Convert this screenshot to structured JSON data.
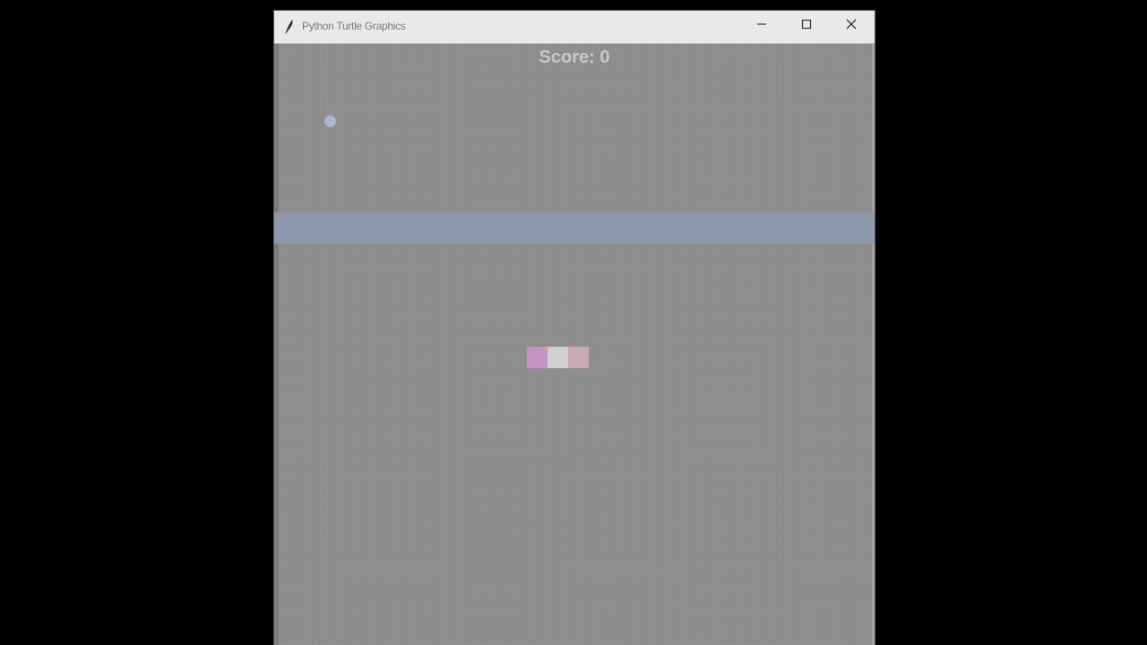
{
  "window": {
    "title": "Python Turtle Graphics",
    "buttons": {
      "minimize": "minimize-icon",
      "maximize": "maximize-icon",
      "close": "close-icon"
    }
  },
  "game": {
    "score_text": "Score: 0",
    "colors": {
      "background": "#8e8e8e",
      "band": "#8e98ad",
      "ball": "#a9b8d2",
      "paddle": [
        "#c495c4",
        "#cfcfcf",
        "#c9a9b4"
      ],
      "score": "#c9c9c9"
    }
  }
}
